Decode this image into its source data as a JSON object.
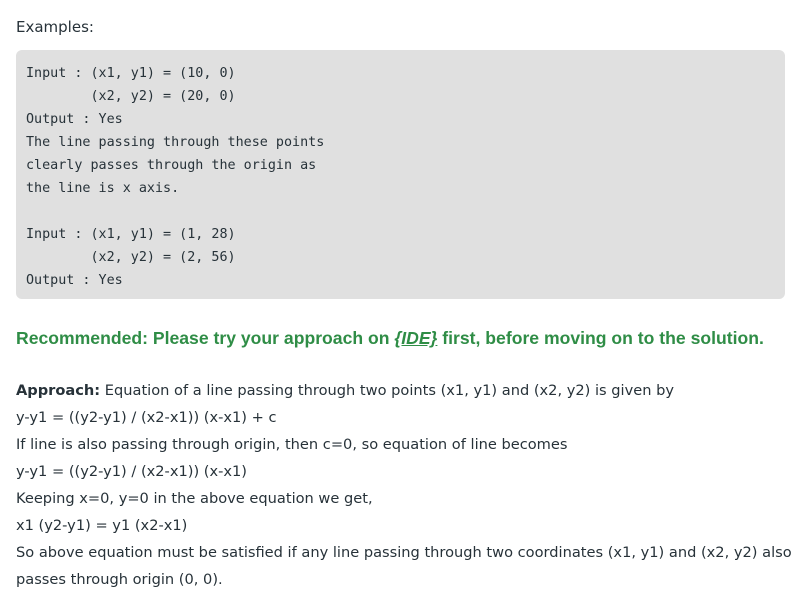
{
  "examples_label": "Examples:",
  "code_example": "Input : (x1, y1) = (10, 0)\n        (x2, y2) = (20, 0)\nOutput : Yes\nThe line passing through these points\nclearly passes through the origin as\nthe line is x axis.\n\nInput : (x1, y1) = (1, 28)\n        (x2, y2) = (2, 56)\nOutput : Yes",
  "recommended": {
    "prefix": "Recommended: Please try your approach on ",
    "link": "{IDE}",
    "suffix": " first, before moving on to the solution."
  },
  "approach": {
    "label": "Approach:",
    "intro": " Equation of a line passing through two points (x1, y1) and (x2, y2) is given by",
    "eq1": "y-y1 = ((y2-y1) / (x2-x1)) (x-x1) + c",
    "line3": "If line is also passing through origin, then c=0, so equation of line becomes",
    "eq2": "y-y1 = ((y2-y1) / (x2-x1)) (x-x1)",
    "line5": "Keeping x=0, y=0 in the above equation we get,",
    "eq3": "x1 (y2-y1) = y1 (x2-x1)",
    "line7a": "So above equation must be satisfied if any line passing through two coordinates (x1, y1) and (x2, y2) also",
    "line7b": "passes through origin (0, 0)."
  }
}
